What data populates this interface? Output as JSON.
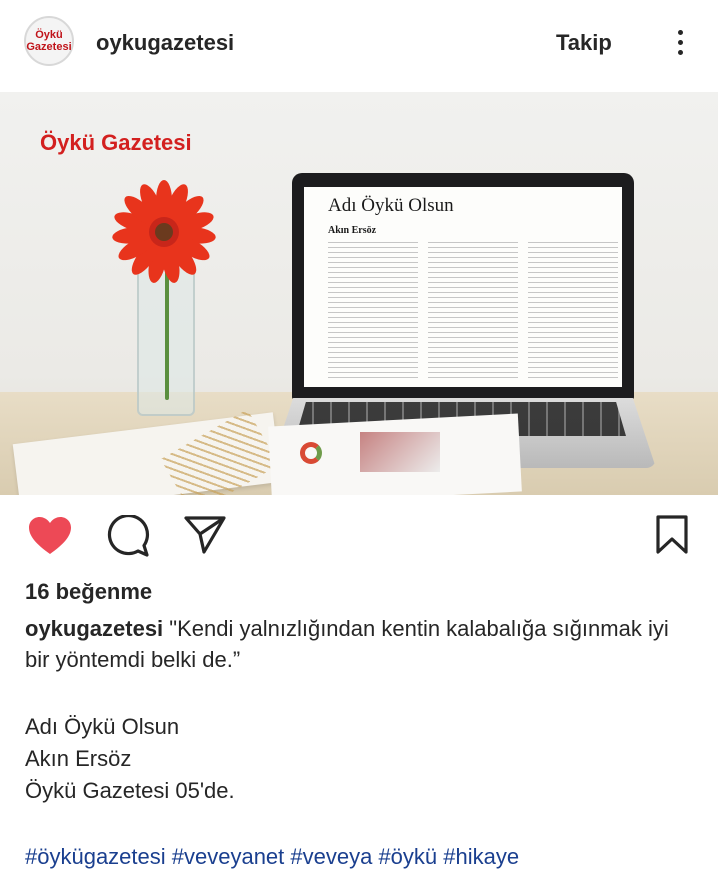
{
  "header": {
    "avatar_text": [
      "Öykü",
      "Gazetesi"
    ],
    "username": "oykugazetesi",
    "follow_label": "Takip",
    "more_icon": "more-vertical-icon"
  },
  "photo": {
    "brand_overlay": "Öykü Gazetesi",
    "screen_title": "Adı Öykü Olsun",
    "screen_author": "Akın Ersöz"
  },
  "actions": {
    "like_icon": "heart-filled-icon",
    "comment_icon": "comment-icon",
    "share_icon": "send-icon",
    "save_icon": "bookmark-icon",
    "like_color": "#ed4956"
  },
  "post": {
    "likes": "16 beğenme",
    "caption_user": "oykugazetesi",
    "caption_text": "\"Kendi yalnızlığından kentin kalabalığa sığınmak iyi bir yöntemdi belki de.”",
    "lines": [
      "Adı Öykü Olsun",
      "Akın Ersöz",
      "Öykü Gazetesi 05'de."
    ],
    "hashtags": "#öykügazetesi #veveyanet #veveya #öykü #hikaye"
  }
}
